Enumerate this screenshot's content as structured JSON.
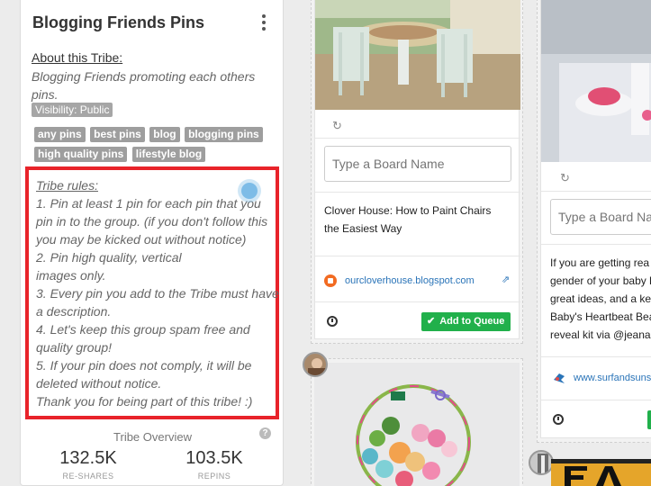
{
  "tribe": {
    "title": "Blogging Friends Pins",
    "about_heading": "About this Tribe:",
    "about_desc": "Blogging Friends promoting each others pins.",
    "visibility": "Visibility: Public",
    "tags": [
      "any pins",
      "best pins",
      "blog",
      "blogging pins",
      "high quality pins",
      "lifestyle blog"
    ],
    "rules_heading": "Tribe rules:",
    "rules": [
      "1. Pin at least 1 pin for each pin that you pin in to the group. (if you don't follow this you may be kicked out without notice)",
      "2. Pin high quality, vertical",
      "images only.",
      "3. Every pin you add to the Tribe must have a description.",
      "4. Let's keep this group spam free and quality group!",
      "5. If your pin does not comply, it will be deleted without notice.",
      "Thank you for being part of this tribe! :)"
    ],
    "overview_title": "Tribe Overview",
    "help_icon_text": "?",
    "stats": [
      {
        "value": "132.5K",
        "label": "RE-SHARES"
      },
      {
        "value": "103.5K",
        "label": "REPINS"
      }
    ]
  },
  "pins": [
    {
      "board_placeholder": "Type a Board Name",
      "description": "Clover House: How to Paint Chairs the Easiest Way",
      "source": "ourcloverhouse.blogspot.com",
      "queue_label": "Add to Queue"
    },
    {
      "board_placeholder": "Type a Board Na",
      "description_lines": [
        "If you are getting rea",
        "gender of your baby l",
        "great ideas, and a ke",
        "Baby's Heartbeat Bea",
        "reveal kit via @jeanab"
      ],
      "source": "www.surfandsuns"
    }
  ],
  "icons": {
    "repin": "↻",
    "external": "⇗",
    "check": "✔"
  },
  "colors": {
    "highlight_red": "#e8232a",
    "queue_green": "#21b04b",
    "link_blue": "#2a74b8"
  }
}
